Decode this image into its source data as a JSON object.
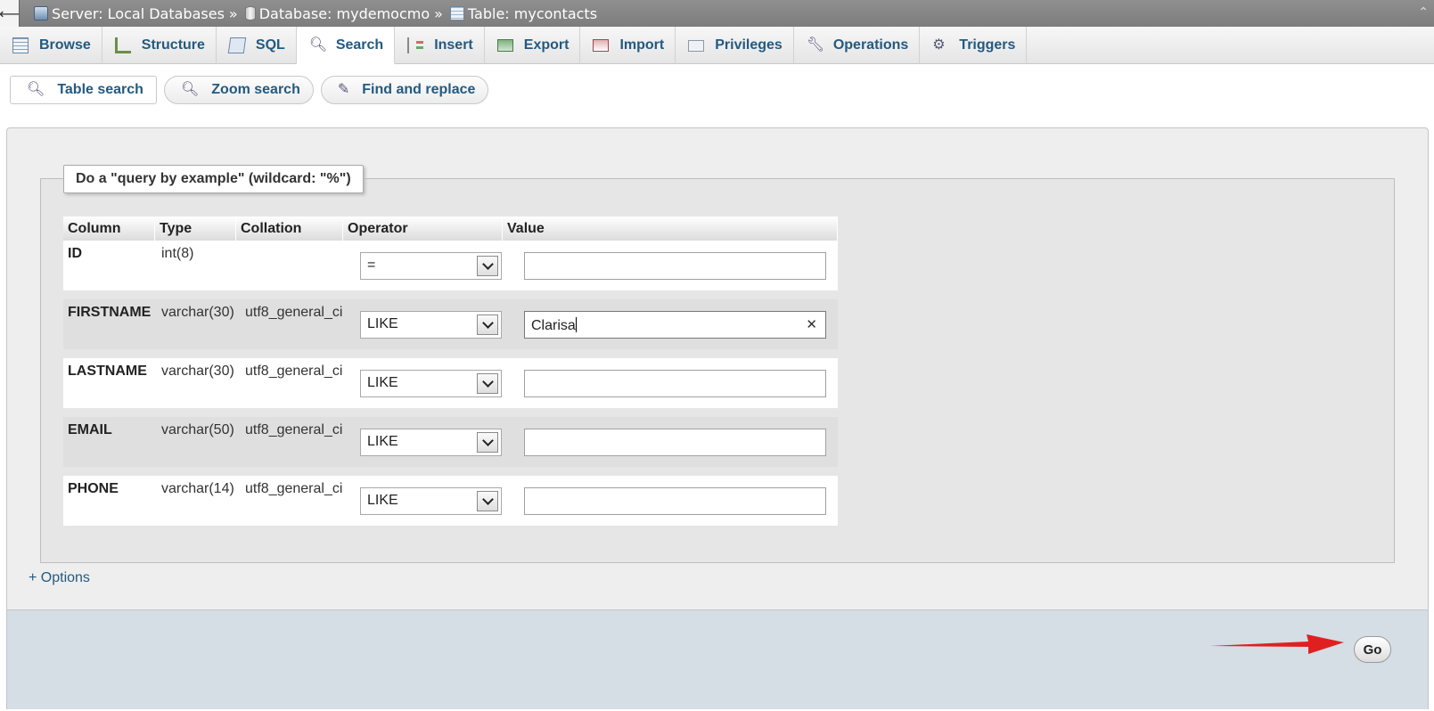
{
  "breadcrumb": {
    "server": "Server: Local Databases",
    "database": "Database: mydemocmo",
    "table": "Table: mycontacts",
    "separator": "»"
  },
  "tabs": [
    {
      "label": "Browse",
      "icon": "browse-icon"
    },
    {
      "label": "Structure",
      "icon": "structure-icon"
    },
    {
      "label": "SQL",
      "icon": "sql-icon"
    },
    {
      "label": "Search",
      "icon": "search-icon",
      "active": true
    },
    {
      "label": "Insert",
      "icon": "insert-icon"
    },
    {
      "label": "Export",
      "icon": "export-icon"
    },
    {
      "label": "Import",
      "icon": "import-icon"
    },
    {
      "label": "Privileges",
      "icon": "privileges-icon"
    },
    {
      "label": "Operations",
      "icon": "wrench-icon"
    },
    {
      "label": "Triggers",
      "icon": "triggers-icon"
    }
  ],
  "subtabs": [
    {
      "label": "Table search"
    },
    {
      "label": "Zoom search"
    },
    {
      "label": "Find and replace"
    }
  ],
  "form": {
    "legend": "Do a \"query by example\" (wildcard: \"%\")",
    "headers": {
      "column": "Column",
      "type": "Type",
      "collation": "Collation",
      "operator": "Operator",
      "value": "Value"
    },
    "rows": [
      {
        "column": "ID",
        "type": "int(8)",
        "collation": "",
        "operator": "=",
        "value": ""
      },
      {
        "column": "FIRSTNAME",
        "type": "varchar(30)",
        "collation": "utf8_general_ci",
        "operator": "LIKE",
        "value": "Clarisa"
      },
      {
        "column": "LASTNAME",
        "type": "varchar(30)",
        "collation": "utf8_general_ci",
        "operator": "LIKE",
        "value": ""
      },
      {
        "column": "EMAIL",
        "type": "varchar(50)",
        "collation": "utf8_general_ci",
        "operator": "LIKE",
        "value": ""
      },
      {
        "column": "PHONE",
        "type": "varchar(14)",
        "collation": "utf8_general_ci",
        "operator": "LIKE",
        "value": ""
      }
    ],
    "options_label": "+ Options",
    "go_label": "Go"
  },
  "colors": {
    "link": "#235a81",
    "annotation_arrow": "#e02020"
  }
}
